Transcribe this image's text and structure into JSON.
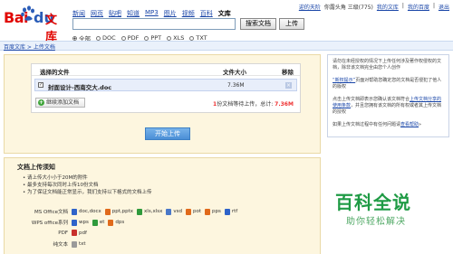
{
  "logo": {
    "bai": "Bai",
    "du": "du",
    "wenku": "文库"
  },
  "nav": {
    "items": [
      "新闻",
      "网页",
      "贴吧",
      "知道",
      "MP3",
      "图片",
      "视频",
      "百科",
      "文库"
    ],
    "active_index": 8
  },
  "search": {
    "button_label": "搜索文档",
    "upload_label": "上传"
  },
  "filters": {
    "options": [
      "全部",
      "DOC",
      "PDF",
      "PPT",
      "XLS",
      "TXT"
    ],
    "selected": "全部"
  },
  "userbar": {
    "user": "迎的天阶",
    "status": "你露头角 三级(775)",
    "links": [
      "我的文库",
      "我的百度",
      "退出"
    ]
  },
  "breadcrumb": {
    "text": "百度文库 > 上传文档"
  },
  "upload": {
    "col_file": "选择的文件",
    "col_size": "文件大小",
    "col_remove": "移除",
    "file_name": "封面设计-西南交大.doc",
    "file_size": "7.36M",
    "add_more": "继续添加文档",
    "summary_prefix": "1",
    "summary_mid": "份文档等待上传，总计:",
    "summary_total": "7.36M",
    "start": "开始上传"
  },
  "requirements": {
    "title": "文档上传须知",
    "rules": [
      "请上传大小小于20M的附件",
      "最多支持每次同时上传10份文档",
      "为了保证文档能正常显示，我们支持以下格式的文档上传"
    ],
    "formats": [
      {
        "label": "MS Office文档",
        "types": [
          "doc,docx",
          "ppt,pptx",
          "xls,xlsx",
          "vsd",
          "pot",
          "pps",
          "rtf"
        ]
      },
      {
        "label": "WPS office系列",
        "types": [
          "wps",
          "et",
          "dps"
        ]
      },
      {
        "label": "PDF",
        "types": [
          "pdf"
        ]
      },
      {
        "label": "纯文本",
        "types": [
          "txt"
        ]
      }
    ]
  },
  "tips": {
    "p1": "请勿在未经授权的情况下上传任何涉及著作权侵权的文档，除非该文档完全由您个人创作",
    "p2_link": "“新权提示”",
    "p2": "页面对帮助您确定您的文档是否侵犯了他人的版权",
    "p3_pre": "点击上传文档即表示您确认该文档符合",
    "p3_link": "上传文档分享的使用条款",
    "p3": "，并且您拥有该文档的所有权或者其上传文档的授权",
    "p4_pre": "如果上传文档过程中有任何问题请",
    "p4_link": "查看帮助",
    "p4": "»"
  },
  "watermark": {
    "big": "百科全说",
    "small": "助你轻松解决"
  },
  "colors": {
    "accent": "#1a46a8",
    "panel_bg": "#fdf6df",
    "primary_button": "#4a8ed6",
    "brand_red": "#e10602"
  },
  "icons": [
    "baidu-paw-icon",
    "checkbox-icon",
    "remove-icon",
    "add-icon",
    "doc-icon",
    "ppt-icon",
    "xls-icon",
    "wps-icon",
    "pdf-icon",
    "txt-icon"
  ]
}
